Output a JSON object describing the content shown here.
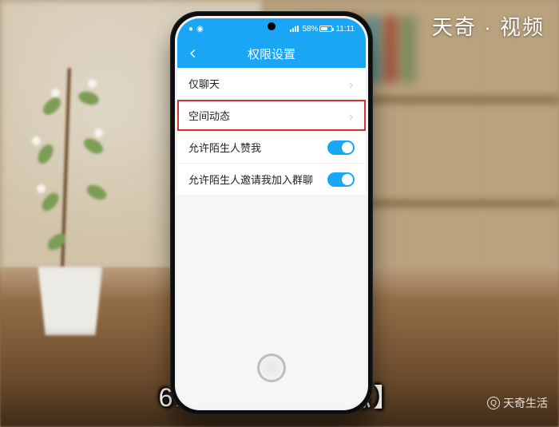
{
  "brand": {
    "top": "天奇 · 视频",
    "bottom": "天奇生活"
  },
  "caption": "6.点击【空间动态】",
  "status": {
    "battery_text": "58%",
    "time": "11:11"
  },
  "appbar": {
    "title": "权限设置"
  },
  "rows": {
    "chat_only": {
      "label": "仅聊天"
    },
    "space": {
      "label": "空间动态"
    },
    "like": {
      "label": "允许陌生人赞我"
    },
    "group": {
      "label": "允许陌生人邀请我加入群聊"
    }
  }
}
